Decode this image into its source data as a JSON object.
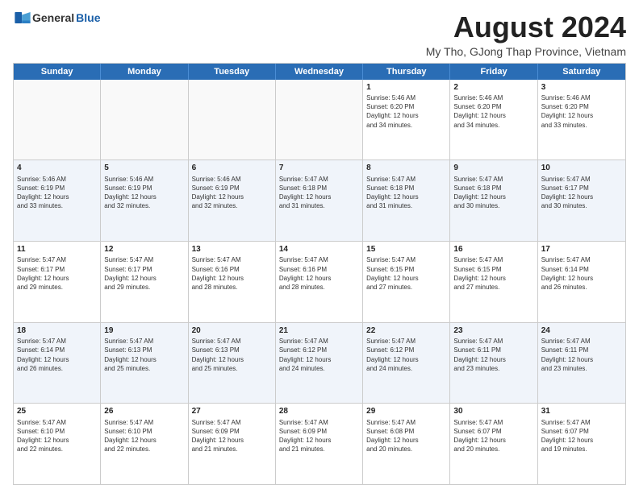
{
  "logo": {
    "general": "General",
    "blue": "Blue"
  },
  "title": "August 2024",
  "subtitle": "My Tho, GJong Thap Province, Vietnam",
  "days": [
    "Sunday",
    "Monday",
    "Tuesday",
    "Wednesday",
    "Thursday",
    "Friday",
    "Saturday"
  ],
  "weeks": [
    [
      {
        "day": "",
        "info": ""
      },
      {
        "day": "",
        "info": ""
      },
      {
        "day": "",
        "info": ""
      },
      {
        "day": "",
        "info": ""
      },
      {
        "day": "1",
        "info": "Sunrise: 5:46 AM\nSunset: 6:20 PM\nDaylight: 12 hours\nand 34 minutes."
      },
      {
        "day": "2",
        "info": "Sunrise: 5:46 AM\nSunset: 6:20 PM\nDaylight: 12 hours\nand 34 minutes."
      },
      {
        "day": "3",
        "info": "Sunrise: 5:46 AM\nSunset: 6:20 PM\nDaylight: 12 hours\nand 33 minutes."
      }
    ],
    [
      {
        "day": "4",
        "info": "Sunrise: 5:46 AM\nSunset: 6:19 PM\nDaylight: 12 hours\nand 33 minutes."
      },
      {
        "day": "5",
        "info": "Sunrise: 5:46 AM\nSunset: 6:19 PM\nDaylight: 12 hours\nand 32 minutes."
      },
      {
        "day": "6",
        "info": "Sunrise: 5:46 AM\nSunset: 6:19 PM\nDaylight: 12 hours\nand 32 minutes."
      },
      {
        "day": "7",
        "info": "Sunrise: 5:47 AM\nSunset: 6:18 PM\nDaylight: 12 hours\nand 31 minutes."
      },
      {
        "day": "8",
        "info": "Sunrise: 5:47 AM\nSunset: 6:18 PM\nDaylight: 12 hours\nand 31 minutes."
      },
      {
        "day": "9",
        "info": "Sunrise: 5:47 AM\nSunset: 6:18 PM\nDaylight: 12 hours\nand 30 minutes."
      },
      {
        "day": "10",
        "info": "Sunrise: 5:47 AM\nSunset: 6:17 PM\nDaylight: 12 hours\nand 30 minutes."
      }
    ],
    [
      {
        "day": "11",
        "info": "Sunrise: 5:47 AM\nSunset: 6:17 PM\nDaylight: 12 hours\nand 29 minutes."
      },
      {
        "day": "12",
        "info": "Sunrise: 5:47 AM\nSunset: 6:17 PM\nDaylight: 12 hours\nand 29 minutes."
      },
      {
        "day": "13",
        "info": "Sunrise: 5:47 AM\nSunset: 6:16 PM\nDaylight: 12 hours\nand 28 minutes."
      },
      {
        "day": "14",
        "info": "Sunrise: 5:47 AM\nSunset: 6:16 PM\nDaylight: 12 hours\nand 28 minutes."
      },
      {
        "day": "15",
        "info": "Sunrise: 5:47 AM\nSunset: 6:15 PM\nDaylight: 12 hours\nand 27 minutes."
      },
      {
        "day": "16",
        "info": "Sunrise: 5:47 AM\nSunset: 6:15 PM\nDaylight: 12 hours\nand 27 minutes."
      },
      {
        "day": "17",
        "info": "Sunrise: 5:47 AM\nSunset: 6:14 PM\nDaylight: 12 hours\nand 26 minutes."
      }
    ],
    [
      {
        "day": "18",
        "info": "Sunrise: 5:47 AM\nSunset: 6:14 PM\nDaylight: 12 hours\nand 26 minutes."
      },
      {
        "day": "19",
        "info": "Sunrise: 5:47 AM\nSunset: 6:13 PM\nDaylight: 12 hours\nand 25 minutes."
      },
      {
        "day": "20",
        "info": "Sunrise: 5:47 AM\nSunset: 6:13 PM\nDaylight: 12 hours\nand 25 minutes."
      },
      {
        "day": "21",
        "info": "Sunrise: 5:47 AM\nSunset: 6:12 PM\nDaylight: 12 hours\nand 24 minutes."
      },
      {
        "day": "22",
        "info": "Sunrise: 5:47 AM\nSunset: 6:12 PM\nDaylight: 12 hours\nand 24 minutes."
      },
      {
        "day": "23",
        "info": "Sunrise: 5:47 AM\nSunset: 6:11 PM\nDaylight: 12 hours\nand 23 minutes."
      },
      {
        "day": "24",
        "info": "Sunrise: 5:47 AM\nSunset: 6:11 PM\nDaylight: 12 hours\nand 23 minutes."
      }
    ],
    [
      {
        "day": "25",
        "info": "Sunrise: 5:47 AM\nSunset: 6:10 PM\nDaylight: 12 hours\nand 22 minutes."
      },
      {
        "day": "26",
        "info": "Sunrise: 5:47 AM\nSunset: 6:10 PM\nDaylight: 12 hours\nand 22 minutes."
      },
      {
        "day": "27",
        "info": "Sunrise: 5:47 AM\nSunset: 6:09 PM\nDaylight: 12 hours\nand 21 minutes."
      },
      {
        "day": "28",
        "info": "Sunrise: 5:47 AM\nSunset: 6:09 PM\nDaylight: 12 hours\nand 21 minutes."
      },
      {
        "day": "29",
        "info": "Sunrise: 5:47 AM\nSunset: 6:08 PM\nDaylight: 12 hours\nand 20 minutes."
      },
      {
        "day": "30",
        "info": "Sunrise: 5:47 AM\nSunset: 6:07 PM\nDaylight: 12 hours\nand 20 minutes."
      },
      {
        "day": "31",
        "info": "Sunrise: 5:47 AM\nSunset: 6:07 PM\nDaylight: 12 hours\nand 19 minutes."
      }
    ]
  ]
}
